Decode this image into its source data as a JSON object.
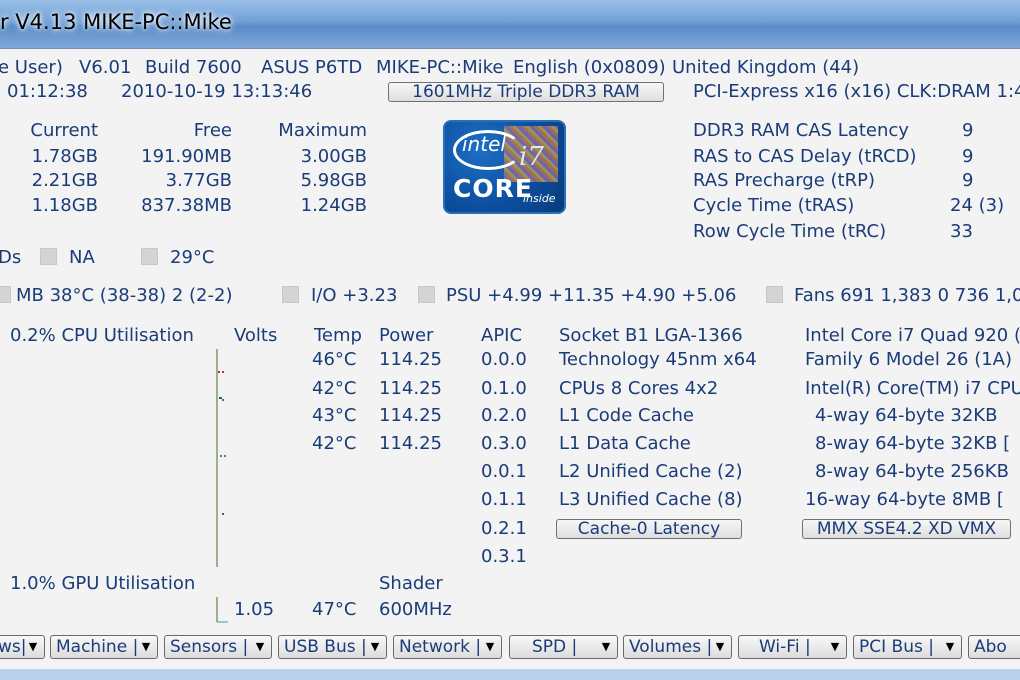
{
  "window": {
    "title": "r V4.13 MIKE-PC::Mike"
  },
  "system": {
    "line1": [
      "e User)",
      "V6.01",
      "Build 7600",
      "ASUS P6TD",
      "MIKE-PC::Mike",
      "English (0x0809)",
      "United Kingdom (44)"
    ],
    "uptime": "01:12:38",
    "datetime": "2010-10-19 13:13:46",
    "ram_button": "1601MHz Triple DDR3 RAM",
    "pci": "PCI-Express x16 (x16) CLK:DRAM 1:4"
  },
  "memory": {
    "headers": [
      "Current",
      "Free",
      "Maximum"
    ],
    "rows": [
      [
        "1.78GB",
        "191.90MB",
        "3.00GB"
      ],
      [
        "2.21GB",
        "3.77GB",
        "5.98GB"
      ],
      [
        "1.18GB",
        "837.38MB",
        "1.24GB"
      ]
    ]
  },
  "timings": [
    {
      "label": "DDR3 RAM CAS Latency",
      "value": "9"
    },
    {
      "label": "RAS to CAS Delay (tRCD)",
      "value": "9"
    },
    {
      "label": "RAS Precharge (tRP)",
      "value": "9"
    },
    {
      "label": "Cycle Time (tRAS)",
      "value": "24 (3)"
    },
    {
      "label": "Row Cycle Time (tRC)",
      "value": "33"
    }
  ],
  "sensors": {
    "row1": {
      "ods": "Ds",
      "na": "NA",
      "temp": "29°C"
    },
    "row2": {
      "mb": "MB 38°C (38-38) 2 (2-2)",
      "io": "I/O +3.23",
      "psu": "PSU +4.99 +11.35 +4.90 +5.06",
      "fans": "Fans 691 1,383 0 736 1,0"
    }
  },
  "cpu": {
    "util": "0.2% CPU Utilisation",
    "headers": [
      "Volts",
      "Temp",
      "Power",
      "APIC"
    ],
    "cores": [
      {
        "temp": "46°C",
        "power": "114.25"
      },
      {
        "temp": "42°C",
        "power": "114.25"
      },
      {
        "temp": "43°C",
        "power": "114.25"
      },
      {
        "temp": "42°C",
        "power": "114.25"
      }
    ],
    "apic": [
      "0.0.0",
      "0.1.0",
      "0.2.0",
      "0.3.0",
      "0.0.1",
      "0.1.1",
      "0.2.1",
      "0.3.1"
    ]
  },
  "cpuinfo": {
    "left": [
      "Socket B1 LGA-1366",
      "Technology 45nm  x64",
      "CPUs 8 Cores 4x2",
      "L1 Code Cache",
      "L1 Data Cache",
      "L2 Unified Cache (2)",
      "L3 Unified Cache (8)"
    ],
    "right": [
      "Intel Core i7 Quad 920 (",
      "Family 6  Model 26 (1A)",
      "Intel(R) Core(TM) i7 CPU",
      "4-way 64-byte  32KB",
      "8-way 64-byte  32KB [",
      "8-way 64-byte  256KB",
      "16-way 64-byte   8MB ["
    ],
    "latency_button": "Cache-0 Latency",
    "features_button": "MMX SSE4.2 XD VMX"
  },
  "gpu": {
    "util": "1.0% GPU Utilisation",
    "shader": "Shader",
    "volts": "1.05",
    "temp": "47°C",
    "clock": "600MHz"
  },
  "tabs": [
    "ws|",
    "Machine |",
    "Sensors |",
    "USB Bus |",
    "Network |",
    "SPD |",
    "Volumes |",
    "Wi-Fi |",
    "PCI Bus |",
    "Abo"
  ],
  "tab_arrow": "▼"
}
